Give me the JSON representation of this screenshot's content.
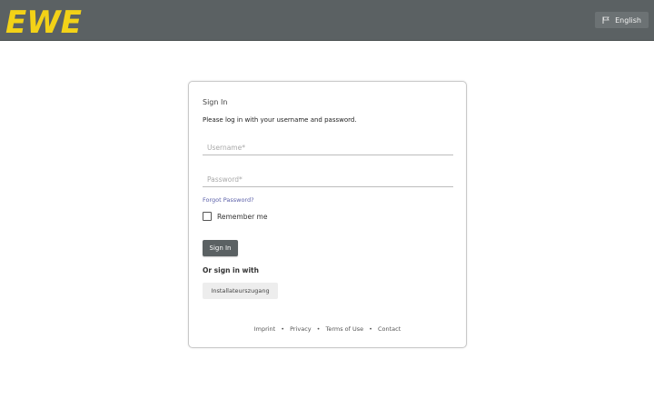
{
  "header": {
    "logo_text": "EWE",
    "brand_color": "#f3d217",
    "bar_color": "#5b6163",
    "language_label": "English"
  },
  "login": {
    "title": "Sign In",
    "intro": "Please log in with your username and password.",
    "username_placeholder": "Username*",
    "password_placeholder": "Password*",
    "forgot_label": "Forgot Password?",
    "remember_label": "Remember me",
    "remember_checked": false,
    "signin_label": "Sign In",
    "or_sign_in_label": "Or sign in with",
    "provider_label": "Installateurszugang"
  },
  "footer": {
    "links": [
      "Imprint",
      "Privacy",
      "Terms of Use",
      "Contact"
    ]
  }
}
